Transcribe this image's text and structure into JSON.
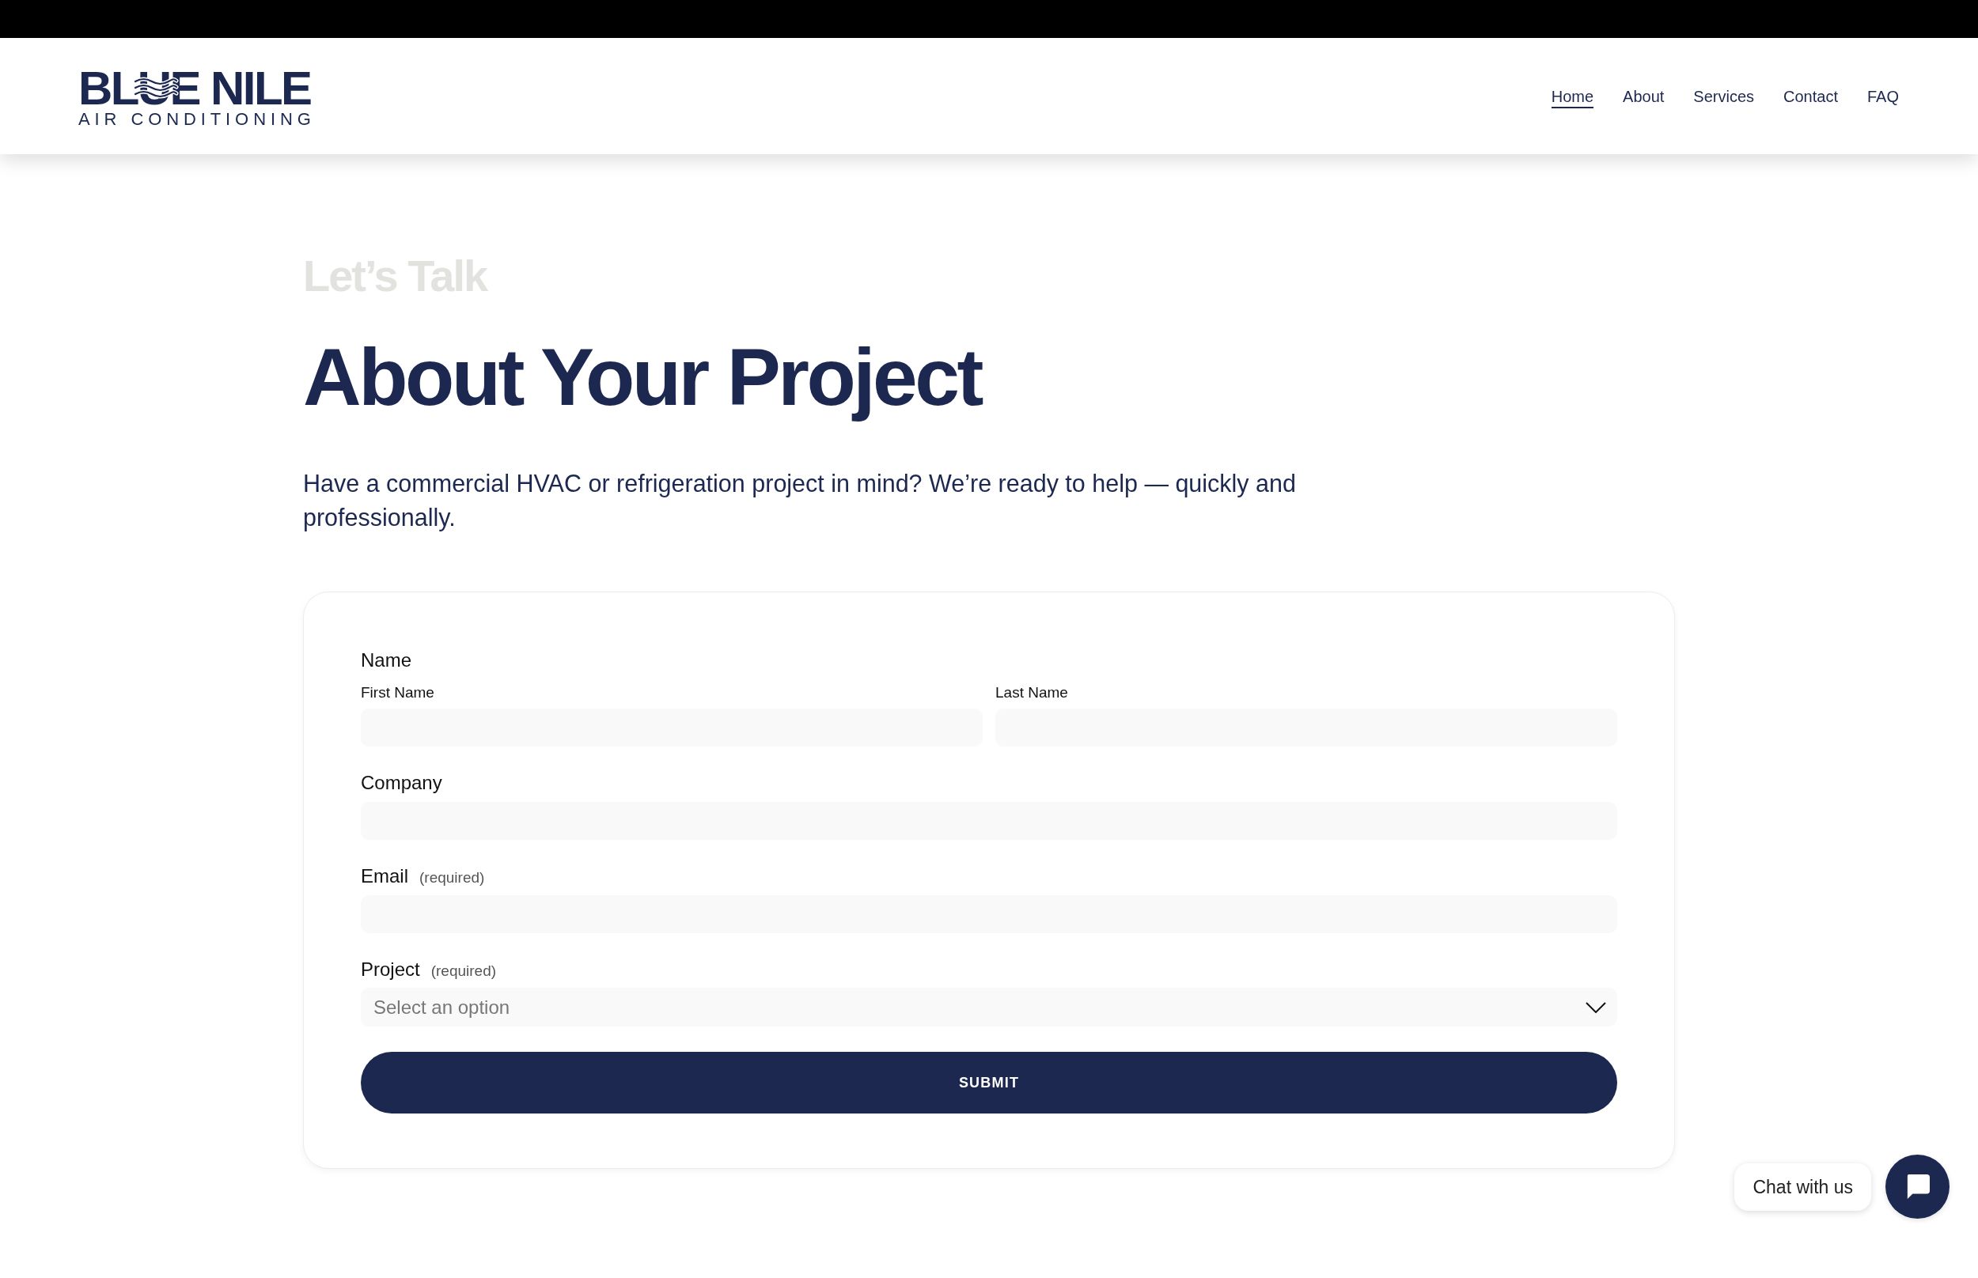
{
  "header": {
    "logo": {
      "wordmark": "BLUE NILE",
      "tagline": "AIR CONDITIONING"
    },
    "nav": [
      {
        "label": "Home",
        "selected": true
      },
      {
        "label": "About",
        "selected": false
      },
      {
        "label": "Services",
        "selected": false
      },
      {
        "label": "Contact",
        "selected": false
      },
      {
        "label": "FAQ",
        "selected": false
      }
    ]
  },
  "intro": {
    "eyebrow": "Let’s Talk",
    "title": "About Your Project",
    "description": "Have a commercial HVAC or refrigeration project in mind? We’re ready to help — quickly and professionally."
  },
  "form": {
    "fields": [
      {
        "kind": "name",
        "label": "Name",
        "parts": [
          {
            "label": "First Name"
          },
          {
            "label": "Last Name"
          }
        ]
      },
      {
        "kind": "text",
        "label": "Company"
      },
      {
        "kind": "text",
        "label": "Email",
        "note": "(required)"
      },
      {
        "kind": "select",
        "label": "Project",
        "note": "(required)",
        "placeholder": "Select an option"
      }
    ],
    "submit": "SUBMIT"
  },
  "chat": {
    "label": "Chat with us"
  }
}
